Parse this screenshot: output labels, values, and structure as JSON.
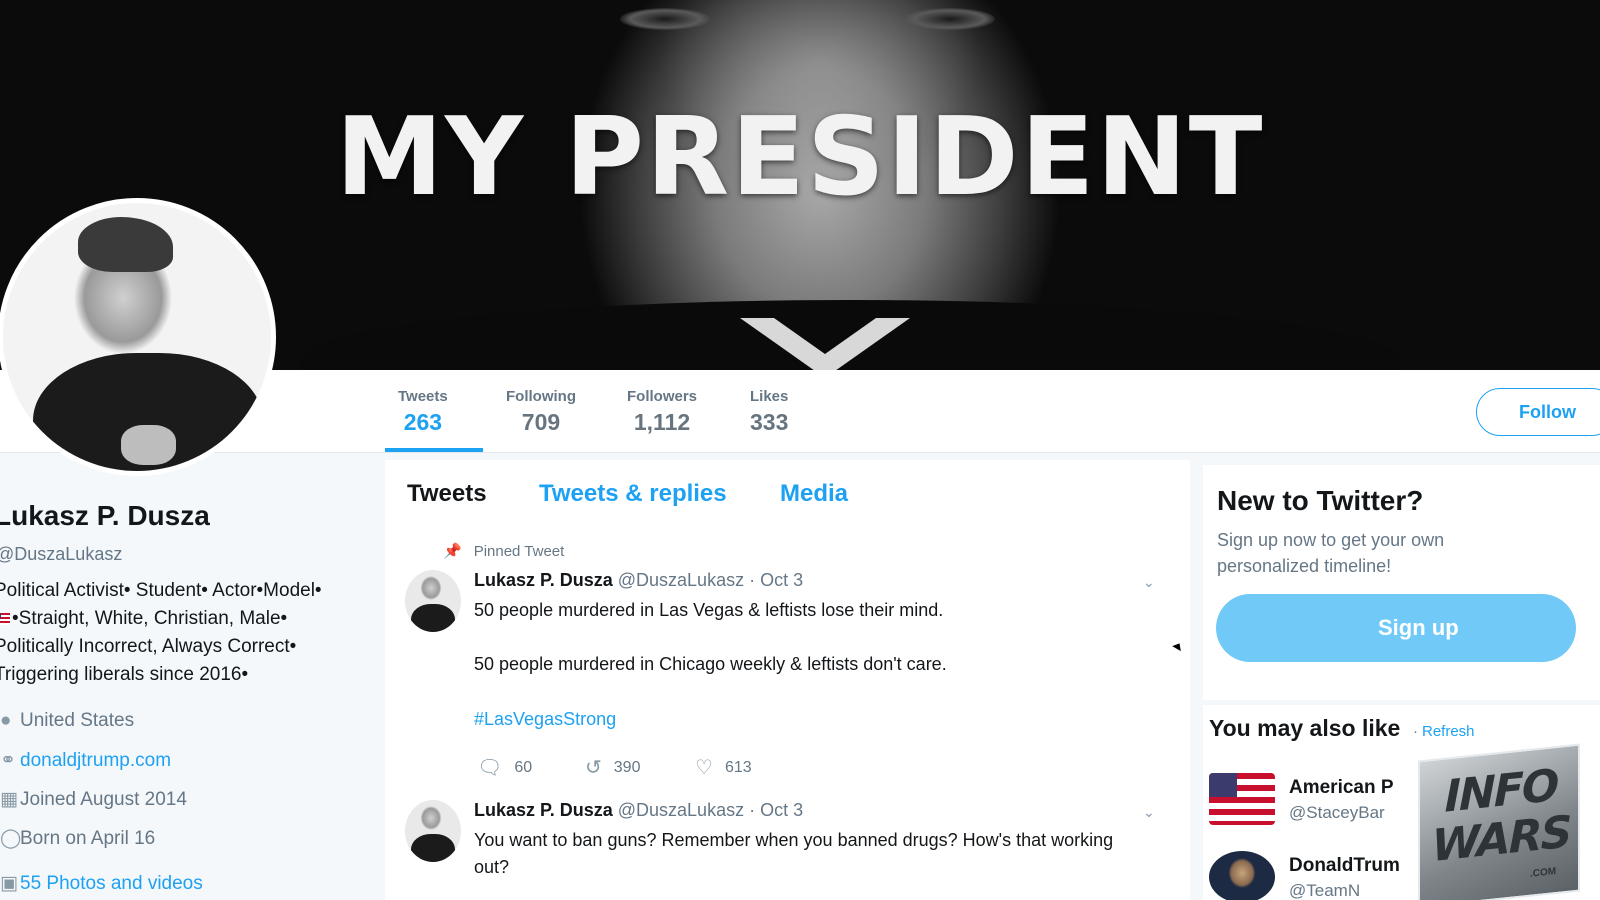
{
  "banner": {
    "title": "MY PRESIDENT"
  },
  "nav": {
    "stats": [
      {
        "label": "Tweets",
        "value": "263"
      },
      {
        "label": "Following",
        "value": "709"
      },
      {
        "label": "Followers",
        "value": "1,112"
      },
      {
        "label": "Likes",
        "value": "333"
      }
    ],
    "follow_label": "Follow"
  },
  "profile": {
    "name": "Lukasz P. Dusza",
    "handle": "@DuszaLukasz",
    "bio": [
      "Political Activist• Student• Actor•Model•",
      "•Straight, White, Christian, Male•",
      "Politically Incorrect, Always Correct•",
      "Triggering liberals since 2016•"
    ],
    "location": "United States",
    "website": "donaldjtrump.com",
    "joined": "Joined August 2014",
    "born": "Born on April 16",
    "photos": "55 Photos and videos"
  },
  "timeline": {
    "tabs": [
      "Tweets",
      "Tweets & replies",
      "Media"
    ],
    "tweets": [
      {
        "pinned_label": "Pinned Tweet",
        "name": "Lukasz P. Dusza",
        "handle": "@DuszaLukasz",
        "date": "· Oct 3",
        "lines": [
          "50 people murdered in Las Vegas & leftists lose their mind.",
          "50 people murdered in Chicago weekly & leftists don't care."
        ],
        "hashtag": "#LasVegasStrong",
        "replies": "60",
        "retweets": "390",
        "likes": "613"
      },
      {
        "name": "Lukasz P. Dusza",
        "handle": "@DuszaLukasz",
        "date": "· Oct 3",
        "lines": [
          "You want to ban guns? Remember when you banned drugs? How's that working",
          "out?"
        ]
      }
    ]
  },
  "sidebar": {
    "signup": {
      "title": "New to Twitter?",
      "desc": "Sign up now to get your own personalized timeline!",
      "button": "Sign up"
    },
    "wtf": {
      "title": "You may also like",
      "refresh": "Refresh",
      "items": [
        {
          "name": "American P",
          "handle": "@StaceyBar"
        },
        {
          "name": "DonaldTrum",
          "handle": "@TeamN"
        }
      ]
    }
  },
  "watermark": {
    "line1": "INFO",
    "line2": "WARS",
    "sub": ".COM"
  },
  "icons": {
    "pin": "pin-icon",
    "reply": "reply-icon",
    "retweet": "retweet-icon",
    "like": "heart-icon",
    "location": "location-icon",
    "link": "link-icon",
    "calendar": "calendar-icon",
    "balloon": "balloon-icon",
    "photo": "photo-icon"
  },
  "colors": {
    "accent": "#1da1f2",
    "signup": "#71c9f8",
    "muted": "#657786"
  }
}
